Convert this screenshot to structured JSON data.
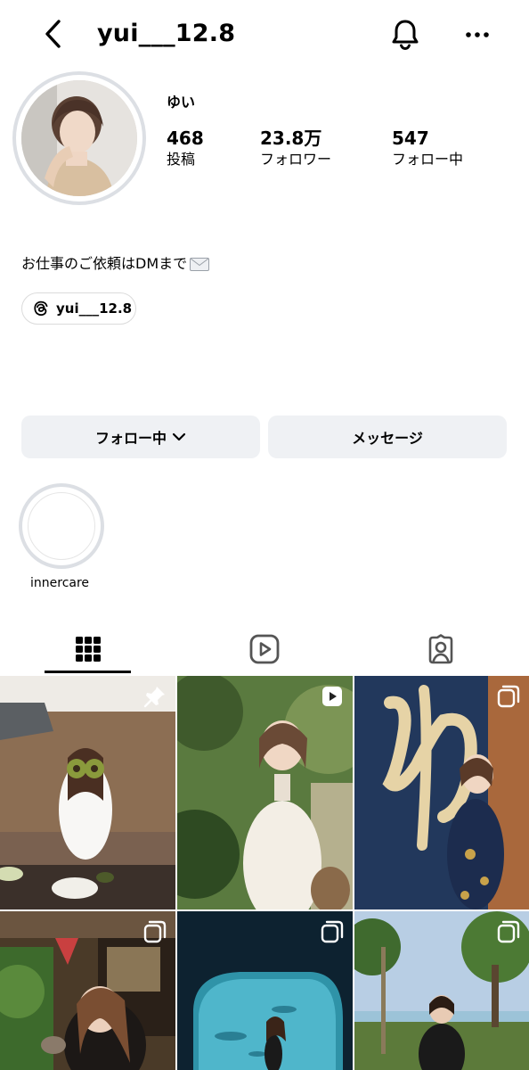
{
  "header": {
    "username": "yui___12.8",
    "back_icon": "chevron-left-icon",
    "bell_icon": "bell-icon",
    "more_icon": "more-horizontal-icon"
  },
  "profile": {
    "display_name": "ゆい",
    "stats": [
      {
        "value": "468",
        "label": "投稿"
      },
      {
        "value": "23.8万",
        "label": "フォロワー"
      },
      {
        "value": "547",
        "label": "フォロー中"
      }
    ],
    "bio": "お仕事のご依頼はDMまで",
    "bio_emoji": "envelope-icon",
    "threads_handle": "yui___12.8"
  },
  "actions": {
    "following_label": "フォロー中",
    "message_label": "メッセージ"
  },
  "highlights": [
    {
      "label": "innercare"
    }
  ],
  "tabs": [
    {
      "name": "grid-tab",
      "icon": "grid-icon",
      "active": true
    },
    {
      "name": "reels-tab",
      "icon": "reels-icon",
      "active": false
    },
    {
      "name": "tagged-tab",
      "icon": "tagged-icon",
      "active": false
    }
  ],
  "posts": [
    {
      "type": "pinned",
      "badge_icon": "pin-icon",
      "colors": [
        "#cfc6b9",
        "#8a6a4c",
        "#f4f2ee"
      ]
    },
    {
      "type": "reel",
      "badge_icon": "play-icon",
      "colors": [
        "#4e6b3a",
        "#a8b98a",
        "#f2ece4"
      ]
    },
    {
      "type": "carousel",
      "badge_icon": "carousel-icon",
      "colors": [
        "#24395f",
        "#e5d3a8",
        "#b46a3c"
      ]
    },
    {
      "type": "carousel",
      "badge_icon": "carousel-icon",
      "colors": [
        "#5a4a36",
        "#2f3f22",
        "#c7a184"
      ]
    },
    {
      "type": "carousel",
      "badge_icon": "carousel-icon",
      "colors": [
        "#0f2a38",
        "#4fb4c8",
        "#d9eef2"
      ]
    },
    {
      "type": "carousel",
      "badge_icon": "carousel-icon",
      "colors": [
        "#b9cde3",
        "#4f6e3a",
        "#1a1a1a"
      ]
    }
  ],
  "colors": {
    "button_bg": "#eff1f4",
    "ring": "#dcdfe4",
    "text": "#000000"
  }
}
